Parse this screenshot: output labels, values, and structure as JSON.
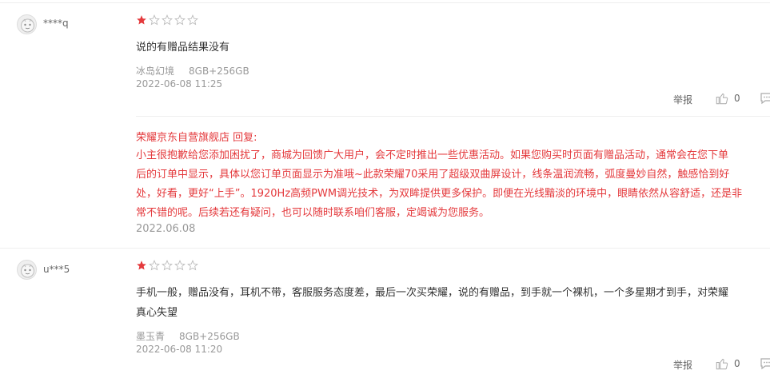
{
  "colors": {
    "accent_red": "#e4393c",
    "star_filled": "#e4393c",
    "star_empty": "#cccccc",
    "text_gray": "#999999"
  },
  "reviews": [
    {
      "username": "****q",
      "rating": 1,
      "rating_max": 5,
      "content_lines": [
        "说的有赠品结果没有"
      ],
      "color_variant": "冰岛幻境",
      "storage": "8GB+256GB",
      "datetime": "2022-06-08 11:25",
      "report_label": "举报",
      "like_count": "0",
      "icons": [
        "avatar-icon",
        "like-icon",
        "comment-icon"
      ],
      "reply": {
        "title": "荣耀京东自营旗舰店 回复:",
        "lines": [
          "小主很抱歉给您添加困扰了，商城为回馈广大用户，会不定时推出一些优惠活动。如果您购买时页面有赠品活动，通常会在您下单",
          "后的订单中显示，具体以您订单页面显示为准哦~此款荣耀70采用了超级双曲屏设计，线条温润流畅，弧度曼妙自然，触感恰到好",
          "处，好看，更好“上手”。1920Hz高频PWM调光技术，为双眸提供更多保护。即便在光线黯淡的环境中，眼睛依然从容舒适，还是非",
          "常不错的呢。后续若还有疑问，也可以随时联系咱们客服，定竭诚为您服务。"
        ],
        "date": "2022.06.08"
      }
    },
    {
      "username": "u***5",
      "rating": 1,
      "rating_max": 5,
      "content_lines": [
        "手机一般，赠品没有，耳机不带，客服服务态度差，最后一次买荣耀，说的有赠品，到手就一个裸机，一个多星期才到手，对荣耀",
        "真心失望"
      ],
      "color_variant": "墨玉青",
      "storage": "8GB+256GB",
      "datetime": "2022-06-08 11:20",
      "report_label": "举报",
      "like_count": "0",
      "icons": [
        "avatar-icon",
        "like-icon",
        "comment-icon"
      ]
    }
  ]
}
